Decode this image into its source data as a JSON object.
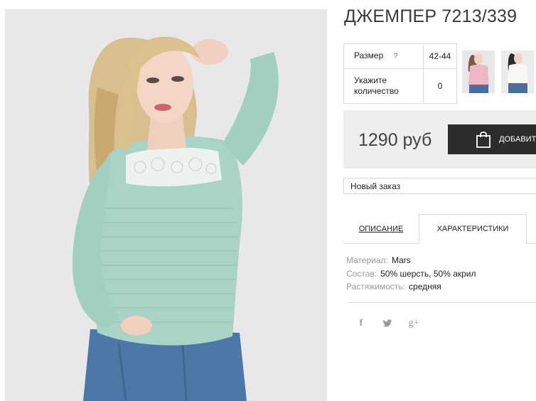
{
  "product": {
    "title": "ДЖЕМПЕР 7213/339",
    "image_alt": "model wearing mint knitted jumper with lace yoke"
  },
  "options": {
    "size_label": "Размер",
    "size_help": "?",
    "size_value": "42-44",
    "qty_label_line1": "Укажите",
    "qty_label_line2": "количество",
    "qty_value": "0"
  },
  "price": {
    "value": "1290 руб",
    "add_button": "ДОБАВИТЬ"
  },
  "order_select": {
    "selected": "Новый заказ"
  },
  "tabs": [
    {
      "label": "ОПИСАНИЕ"
    },
    {
      "label": "ХАРАКТЕРИСТИКИ"
    }
  ],
  "characteristics": [
    {
      "key": "Материал:",
      "value": "Mars"
    },
    {
      "key": "Состав:",
      "value": "50% шерсть, 50% акрил"
    },
    {
      "key": "Растяжимость:",
      "value": "средняя"
    }
  ],
  "social": {
    "facebook": "f",
    "twitter": "twitter-icon",
    "googleplus": "g+"
  },
  "colors": {
    "sweater": "#a9d3c6",
    "price_bg": "#eeeeee",
    "button_bg": "#2c2c2c",
    "jeans": "#4c78a8"
  }
}
